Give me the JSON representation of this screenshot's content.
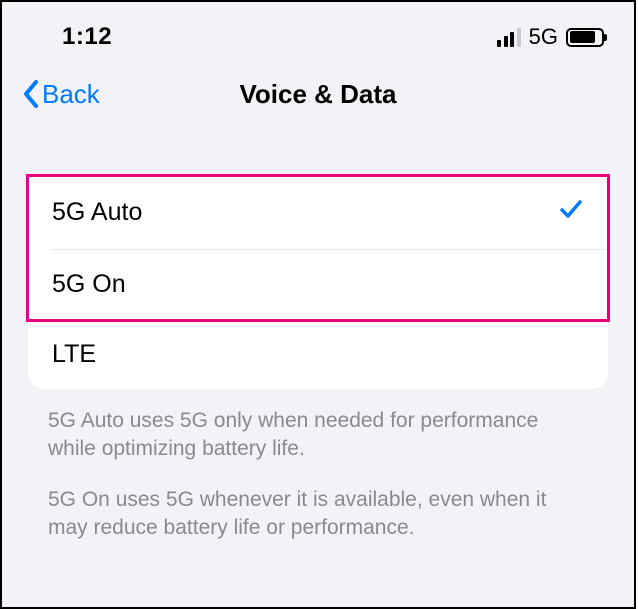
{
  "status_bar": {
    "time": "1:12",
    "network_label": "5G"
  },
  "nav": {
    "back_label": "Back",
    "title": "Voice & Data"
  },
  "options": {
    "item0": {
      "label": "5G Auto",
      "selected": true
    },
    "item1": {
      "label": "5G On",
      "selected": false
    },
    "item2": {
      "label": "LTE",
      "selected": false
    }
  },
  "footer": {
    "p1": "5G Auto uses 5G only when needed for performance while optimizing battery life.",
    "p2": "5G On uses 5G whenever it is available, even when it may reduce battery life or performance."
  },
  "colors": {
    "accent": "#007aff",
    "highlight": "#e6007e",
    "bg": "#f2f2f7",
    "footer_text": "#8a8a8e"
  }
}
